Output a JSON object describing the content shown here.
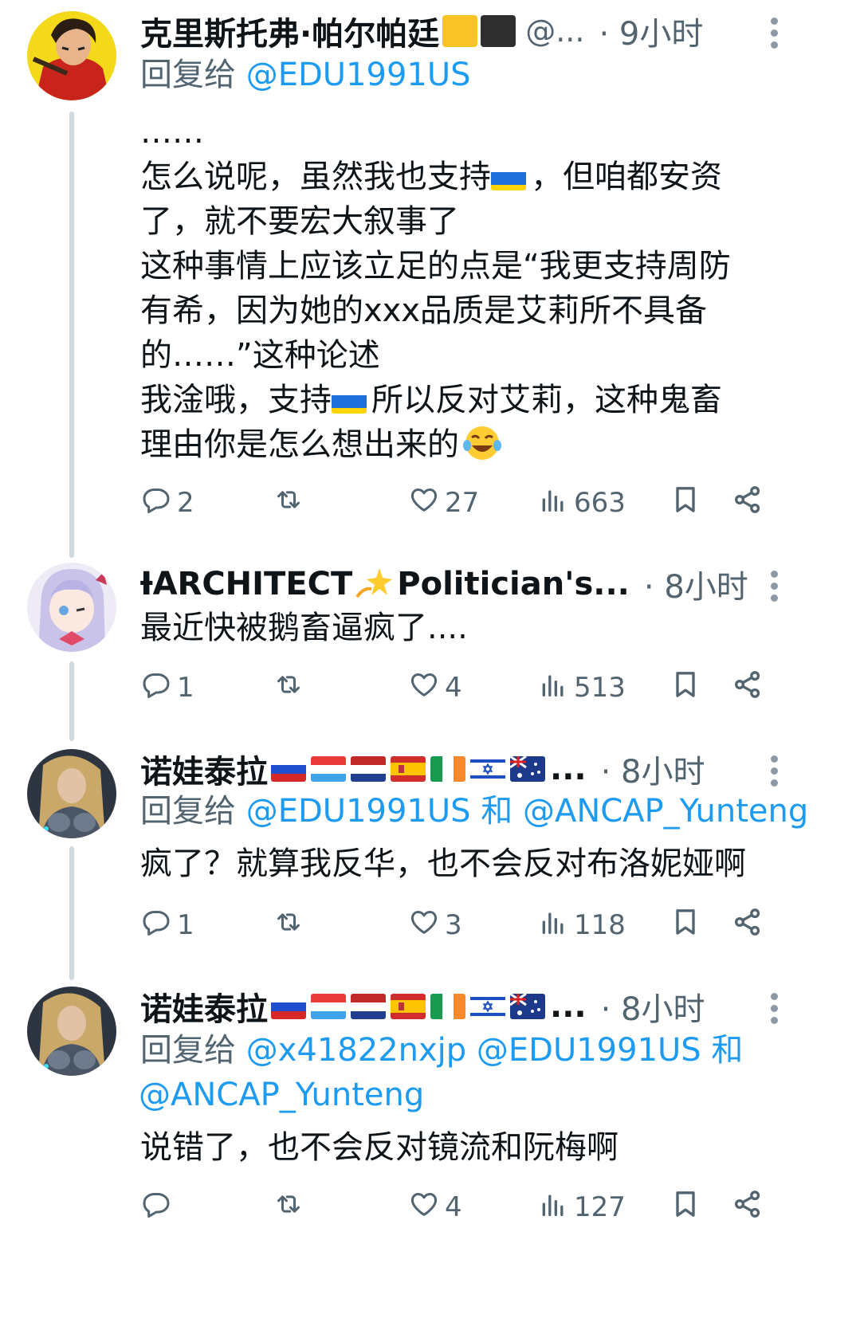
{
  "tweets": [
    {
      "name": "克里斯托弗·帕尔帕廷",
      "handle": "@...",
      "time": "· 9小时",
      "reply_prefix": "回复给",
      "reply_mentions": "@EDU1991US",
      "body": {
        "l1": "……",
        "l2a": "怎么说呢，虽然我也支持",
        "l2b": "，但咱都安资",
        "l3": "了，就不要宏大叙事了",
        "l4": "这种事情上应该立足的点是“我更支持周防",
        "l5": "有希，因为她的xxx品质是艾莉所不具备",
        "l6": "的……”这种论述",
        "l7a": "我淦哦，支持",
        "l7b": "所以反对艾莉，这种鬼畜",
        "l8": "理由你是怎么想出来的"
      },
      "replies": "2",
      "likes": "27",
      "views": "663"
    },
    {
      "name": "ƗARCHITECT",
      "name_tail": "Politician's...",
      "time": "· 8小时",
      "body": {
        "l1": "最近快被鹅畜逼疯了...."
      },
      "replies": "1",
      "likes": "4",
      "views": "513"
    },
    {
      "name": "诺娃泰拉",
      "name_tail": "...",
      "time": "· 8小时",
      "reply_prefix": "回复给",
      "reply_mentions": "@EDU1991US 和 @ANCAP_Yunteng",
      "body": {
        "l1": "疯了？就算我反华，也不会反对布洛妮娅啊"
      },
      "replies": "1",
      "likes": "3",
      "views": "118"
    },
    {
      "name": "诺娃泰拉",
      "name_tail": "...",
      "time": "· 8小时",
      "reply_prefix": "回复给",
      "reply_mentions": "@x41822nxjp @EDU1991US 和",
      "reply_mentions_2": "@ANCAP_Yunteng",
      "body": {
        "l1": "说错了，也不会反对镜流和阮梅啊"
      },
      "replies": "",
      "likes": "4",
      "views": "127"
    }
  ],
  "icons": {
    "reply": "reply-bubble-icon",
    "retweet": "retweet-icon",
    "like": "heart-icon",
    "views": "views-bar-icon",
    "bookmark": "bookmark-icon",
    "share": "share-icon",
    "more": "more-dots-icon"
  },
  "colors": {
    "link": "#1d9bf0",
    "muted": "#536471",
    "text": "#0f1419",
    "thread": "#cfd9de"
  }
}
